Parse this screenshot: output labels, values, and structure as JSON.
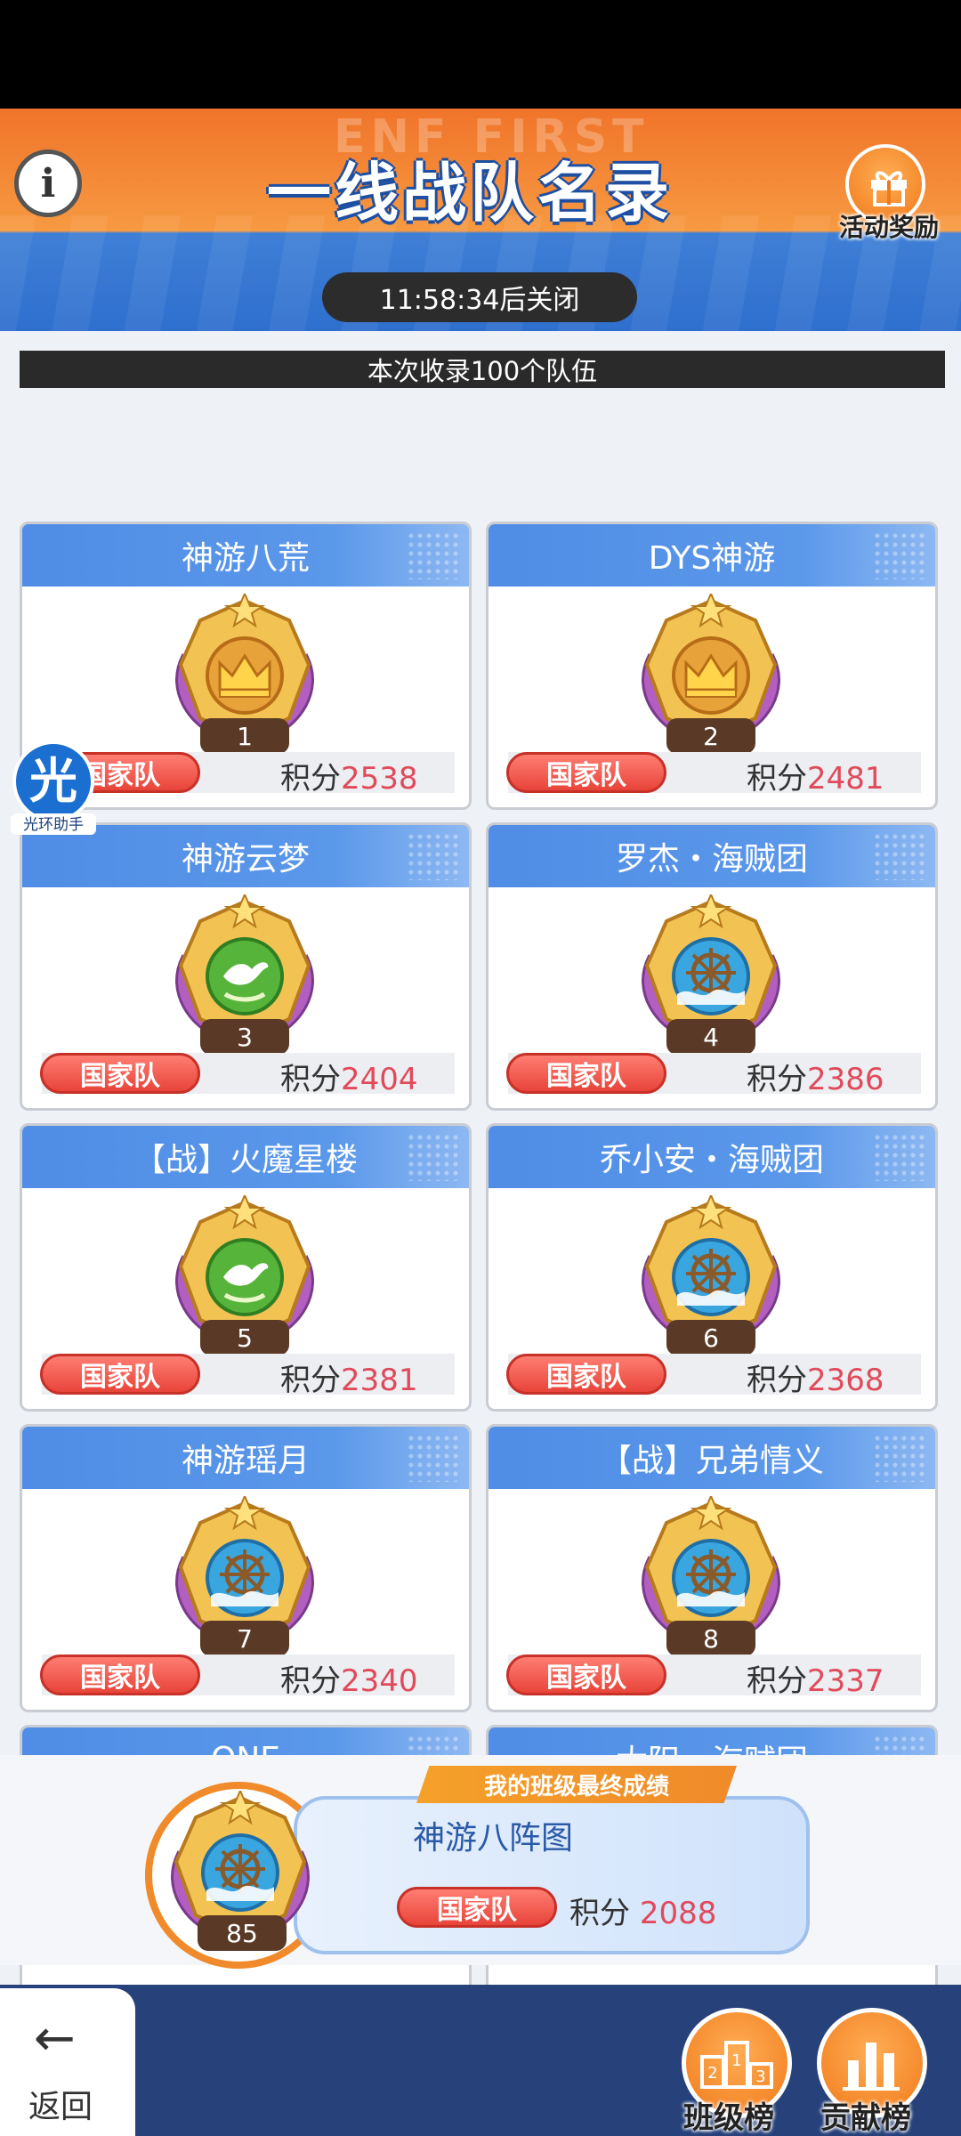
{
  "header": {
    "watermark": "ENF FIRST",
    "title": "一线战队名录",
    "reward_label": "活动奖励",
    "timer": "11:58:34后关闭"
  },
  "record_info": "本次收录100个队伍",
  "floating_helper": {
    "glyph": "光",
    "label": "光环助手"
  },
  "teams": [
    {
      "name": "神游八荒",
      "rank": "1",
      "tag": "国家队",
      "score_label": "积分",
      "score": "2538",
      "emblem": "crown"
    },
    {
      "name": "DYS神游",
      "rank": "2",
      "tag": "国家队",
      "score_label": "积分",
      "score": "2481",
      "emblem": "crown"
    },
    {
      "name": "神游云梦",
      "rank": "3",
      "tag": "国家队",
      "score_label": "积分",
      "score": "2404",
      "emblem": "dove"
    },
    {
      "name": "罗杰・海贼团",
      "rank": "4",
      "tag": "国家队",
      "score_label": "积分",
      "score": "2386",
      "emblem": "wheel"
    },
    {
      "name": "【战】火魔星楼",
      "rank": "5",
      "tag": "国家队",
      "score_label": "积分",
      "score": "2381",
      "emblem": "dove"
    },
    {
      "name": "乔小安・海贼团",
      "rank": "6",
      "tag": "国家队",
      "score_label": "积分",
      "score": "2368",
      "emblem": "wheel"
    },
    {
      "name": "神游瑶月",
      "rank": "7",
      "tag": "国家队",
      "score_label": "积分",
      "score": "2340",
      "emblem": "wheel"
    },
    {
      "name": "【战】兄弟情义",
      "rank": "8",
      "tag": "国家队",
      "score_label": "积分",
      "score": "2337",
      "emblem": "wheel"
    },
    {
      "name": "ONE",
      "emblem": "bubble"
    },
    {
      "name": "太阳・海贼团",
      "emblem": "wheel"
    }
  ],
  "my_team": {
    "ribbon": "我的班级最终成绩",
    "name": "神游八阵图",
    "rank": "85",
    "tag": "国家队",
    "score_label": "积分",
    "score": "2088"
  },
  "nav": {
    "back_label": "返回",
    "class_rank_label": "班级榜",
    "contribution_label": "贡献榜"
  },
  "colors": {
    "accent_orange": "#f08a2a",
    "header_blue": "#4f8de6",
    "score_red": "#e04a5a",
    "bottom_bar": "#27427a"
  }
}
